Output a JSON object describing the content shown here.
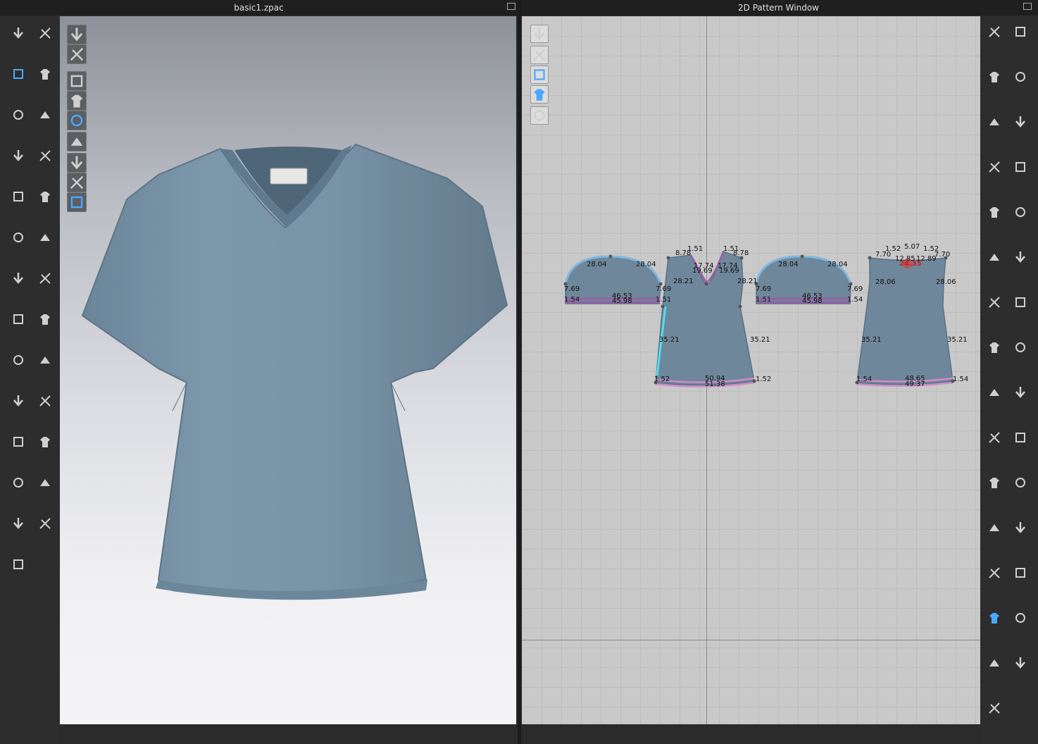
{
  "left_panel": {
    "title": "basic1.zpac"
  },
  "right_panel": {
    "title": "2D Pattern Window"
  },
  "left_toolbar": {
    "icons": [
      "move-down-icon",
      "simulation-icon",
      "select-move-icon",
      "pin-icon",
      "transform-icon",
      "sewing-icon",
      "fold-arrange-icon",
      "arrangement-icon",
      "tack-icon",
      "steam-icon",
      "fabric-icon",
      "texture-icon",
      "needle-icon",
      "brush-icon",
      "button-icon",
      "buttonhole-icon",
      "puckering-icon",
      "zipper-icon",
      "topstitch-icon",
      "avatar-size-icon",
      "fitting-suit-icon",
      "tape-icon",
      "garment-fit-icon",
      "ruler-icon",
      "hanger-icon",
      "shirt-front-icon",
      "shirt-back-icon"
    ]
  },
  "viewport_3d": {
    "tools": [
      "show-3d-garment-icon",
      "show-garment-icon",
      "show-avatar-icon",
      "show-pin-icon",
      "show-skin-icon",
      "show-texture-icon",
      "show-material-icon",
      "show-face-icon",
      "globe-icon"
    ]
  },
  "viewport_2d": {
    "tools": [
      "pencil-icon",
      "shirt-view-icon",
      "info-icon",
      "layer-icon",
      "shirt-lock-icon"
    ],
    "measurements": {
      "sleeve_left": [
        "28.04",
        "28.04",
        "7.69",
        "7.69",
        "46.53",
        "45.98",
        "1.54",
        "1.51"
      ],
      "front": [
        "1.51",
        "1.51",
        "8.78",
        "8.78",
        "17.74",
        "17.74",
        "19.69",
        "19.69",
        "28.21",
        "28.21",
        "35.21",
        "35.21",
        "1.52",
        "1.52",
        "50.94",
        "51.38"
      ],
      "sleeve_right": [
        "28.04",
        "28.04",
        "7.69",
        "7.69",
        "46.53",
        "45.98",
        "1.51",
        "1.54"
      ],
      "back": [
        "1.52",
        "1.52",
        "7.70",
        "7.70",
        "5.07",
        "28.06",
        "28.06",
        "35.21",
        "35.21",
        "1.54",
        "1.54",
        "48.65",
        "49.37",
        "12.85",
        "12.89",
        "24.35"
      ]
    }
  },
  "right_toolbar": {
    "icons": [
      "edit-pattern-icon",
      "edit-point-icon",
      "create-polygon-icon",
      "create-rectangle-icon",
      "create-circle-icon",
      "internal-polygon-icon",
      "create-dart-icon",
      "trace-icon",
      "notch-icon",
      "fold-icon",
      "measure-icon",
      "text-icon",
      "text-style-icon",
      "grid-icon",
      "layer-icon",
      "avatar-icon",
      "seam-line-icon",
      "segment-sewing-icon",
      "free-sewing-icon",
      "check-sewing-icon",
      "stitch-icon",
      "iron-icon",
      "shirt-icon",
      "avatar-arrange-icon",
      "zip-icon",
      "seam-taping-icon",
      "stitch-dashed-icon",
      "elastic-icon",
      "zigzag-icon",
      "add-avatar-icon",
      "gift-icon"
    ]
  }
}
